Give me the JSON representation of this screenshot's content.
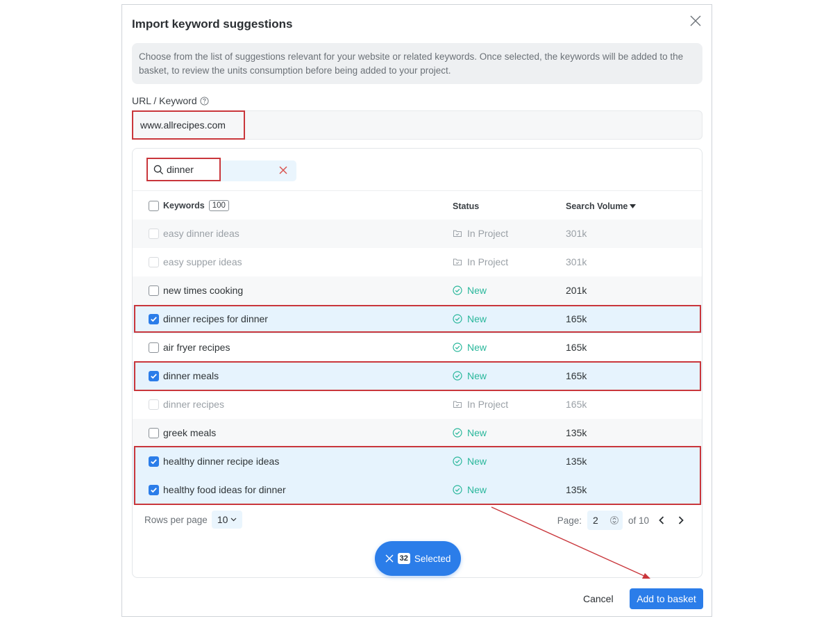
{
  "dialog": {
    "title": "Import keyword suggestions",
    "info": "Choose from the list of suggestions relevant for your website or related keywords. Once selected, the keywords will be added to the basket, to review the units consumption before being added to your project."
  },
  "url_field": {
    "label": "URL / Keyword",
    "value": "www.allrecipes.com"
  },
  "search": {
    "value": "dinner"
  },
  "table": {
    "headers": {
      "keywords": "Keywords",
      "keywords_count": "100",
      "status": "Status",
      "volume": "Search Volume"
    },
    "rows": [
      {
        "keyword": "easy dinner ideas",
        "status": "In Project",
        "volume": "301k"
      },
      {
        "keyword": "easy supper ideas",
        "status": "In Project",
        "volume": "301k"
      },
      {
        "keyword": "new times cooking",
        "status": "New",
        "volume": "201k"
      },
      {
        "keyword": "dinner recipes for dinner",
        "status": "New",
        "volume": "165k"
      },
      {
        "keyword": "air fryer recipes",
        "status": "New",
        "volume": "165k"
      },
      {
        "keyword": "dinner meals",
        "status": "New",
        "volume": "165k"
      },
      {
        "keyword": "dinner recipes",
        "status": "In Project",
        "volume": "165k"
      },
      {
        "keyword": "greek meals",
        "status": "New",
        "volume": "135k"
      },
      {
        "keyword": "healthy dinner recipe ideas",
        "status": "New",
        "volume": "135k"
      },
      {
        "keyword": "healthy food ideas for dinner",
        "status": "New",
        "volume": "135k"
      }
    ]
  },
  "pagination": {
    "rows_label": "Rows per page",
    "rows_value": "10",
    "page_label": "Page:",
    "page_value": "2",
    "of_label": "of 10"
  },
  "selection": {
    "count": "32",
    "label": "Selected"
  },
  "actions": {
    "cancel": "Cancel",
    "add": "Add to basket"
  },
  "colors": {
    "accent": "#2b7de9",
    "new_status": "#29b79b",
    "highlight": "#c9363b"
  }
}
